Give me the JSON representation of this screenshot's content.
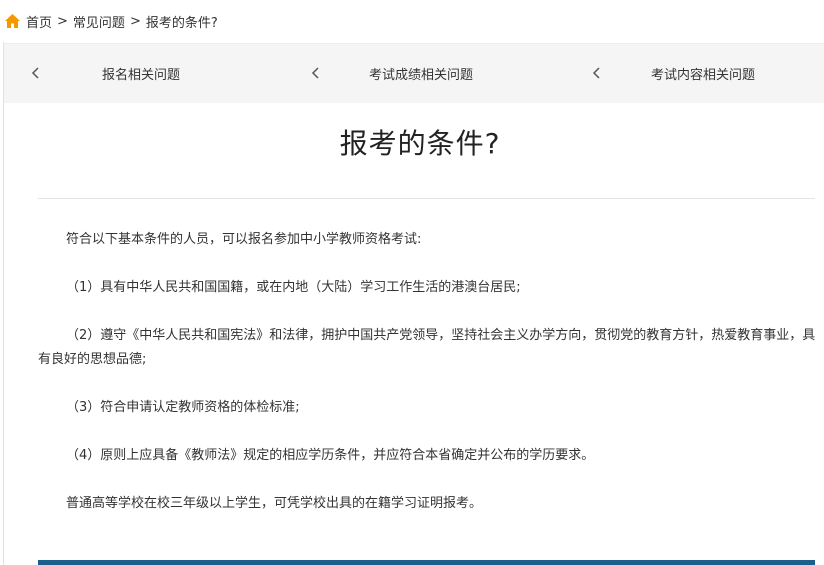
{
  "breadcrumb": {
    "home": "首页",
    "section": "常见问题",
    "current": "报考的条件?",
    "separator": ">"
  },
  "nav": {
    "items": [
      {
        "label": "报名相关问题"
      },
      {
        "label": "考试成绩相关问题"
      },
      {
        "label": "考试内容相关问题"
      }
    ]
  },
  "article": {
    "title": "报考的条件?",
    "paragraphs": [
      "符合以下基本条件的人员，可以报名参加中小学教师资格考试:",
      "（1）具有中华人民共和国国籍，或在内地（大陆）学习工作生活的港澳台居民;",
      "（2）遵守《中华人民共和国宪法》和法律，拥护中国共产党领导，坚持社会主义办学方向，贯彻党的教育方针，热爱教育事业，具有良好的思想品德;",
      "（3）符合申请认定教师资格的体检标准;",
      "（4）原则上应具备《教师法》规定的相应学历条件，并应符合本省确定并公布的学历要求。",
      "普通高等学校在校三年级以上学生，可凭学校出具的在籍学习证明报考。"
    ]
  },
  "colors": {
    "home_icon": "#f39800",
    "bottom_bar": "#1c5f8c",
    "nav_background": "#f5f5f5"
  }
}
